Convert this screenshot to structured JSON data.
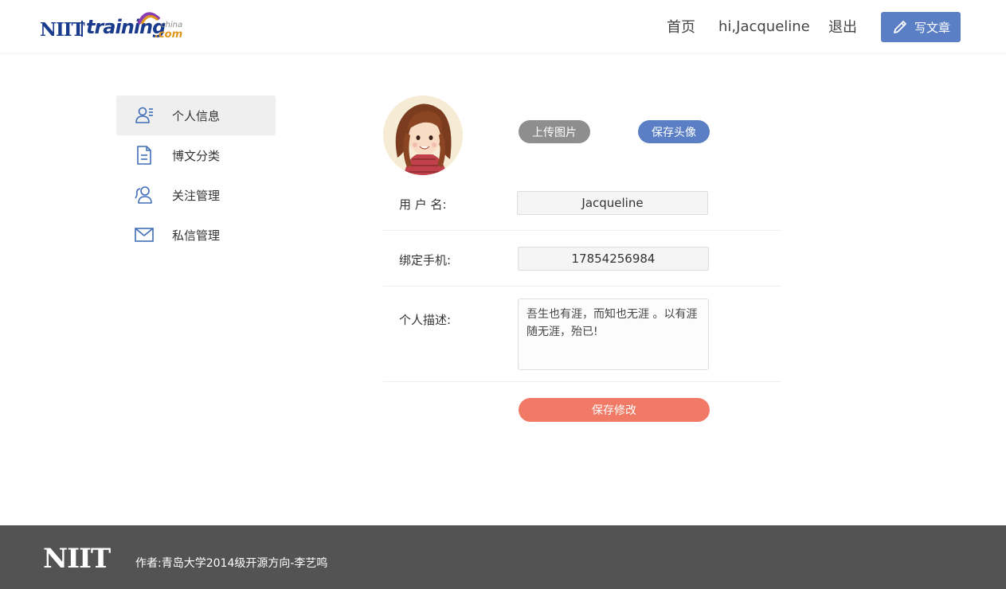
{
  "brand": {
    "logo_niit": "NIIT",
    "logo_training": "training",
    "logo_china": "china",
    "logo_com": ".com",
    "accent": "#5b7fc4"
  },
  "nav": {
    "home": "首页",
    "user_greeting": "hi,Jacqueline",
    "logout": "退出",
    "write_button": "写文章"
  },
  "sidebar": {
    "items": [
      {
        "label": "个人信息",
        "icon": "profile-card-icon",
        "active": true
      },
      {
        "label": "博文分类",
        "icon": "document-icon",
        "active": false
      },
      {
        "label": "关注管理",
        "icon": "users-icon",
        "active": false
      },
      {
        "label": "私信管理",
        "icon": "mail-icon",
        "active": false
      }
    ]
  },
  "profile": {
    "upload_image": "上传图片",
    "save_avatar": "保存头像",
    "username_label": "用 户 名:",
    "username_value": "Jacqueline",
    "phone_label": "绑定手机:",
    "phone_value": "17854256984",
    "description_label": "个人描述:",
    "description_value": "吾生也有涯，而知也无涯 。以有涯随无涯，殆已!",
    "save_changes": "保存修改"
  },
  "colors": {
    "primary": "#5b7fc4",
    "upload_gray": "#8e8e8e",
    "save_coral": "#f07a66",
    "footer_bg": "#535353"
  },
  "footer": {
    "logo": "NIIT",
    "author": "作者:青岛大学2014级开源方向-李艺鸣"
  }
}
